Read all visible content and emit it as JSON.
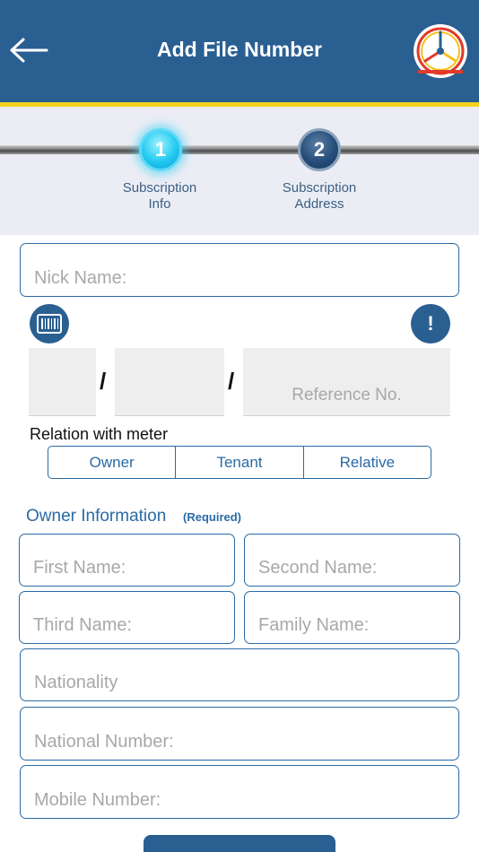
{
  "header": {
    "title": "Add File Number",
    "back_icon": "arrow-left-icon",
    "logo_icon": "utility-logo-icon",
    "color": "#2a5f92",
    "stripe_color": "#f4d21f"
  },
  "stepper": {
    "steps": [
      {
        "number": "1",
        "label_line1": "Subscription",
        "label_line2": "Info",
        "active": true
      },
      {
        "number": "2",
        "label_line1": "Subscription",
        "label_line2": "Address",
        "active": false
      }
    ]
  },
  "form": {
    "nick_name": {
      "value": "",
      "placeholder": "Nick Name:"
    },
    "barcode_icon": "barcode-icon",
    "info_icon": "exclamation-icon",
    "info_symbol": "!",
    "file_number": {
      "part1": {
        "value": "",
        "placeholder": ""
      },
      "part2": {
        "value": "",
        "placeholder": ""
      },
      "reference": {
        "value": "",
        "placeholder": "Reference No."
      },
      "separator": "/"
    },
    "relation": {
      "label": "Relation with meter",
      "options": [
        "Owner",
        "Tenant",
        "Relative"
      ]
    },
    "owner_info": {
      "title": "Owner Information",
      "required": "(Required)",
      "first_name": {
        "value": "",
        "placeholder": "First Name:"
      },
      "second_name": {
        "value": "",
        "placeholder": "Second Name:"
      },
      "third_name": {
        "value": "",
        "placeholder": "Third Name:"
      },
      "family_name": {
        "value": "",
        "placeholder": "Family Name:"
      },
      "nationality": {
        "value": "",
        "placeholder": "Nationality"
      },
      "national_number": {
        "value": "",
        "placeholder": "National Number:"
      },
      "mobile_number": {
        "value": "",
        "placeholder": "Mobile Number:"
      }
    }
  }
}
